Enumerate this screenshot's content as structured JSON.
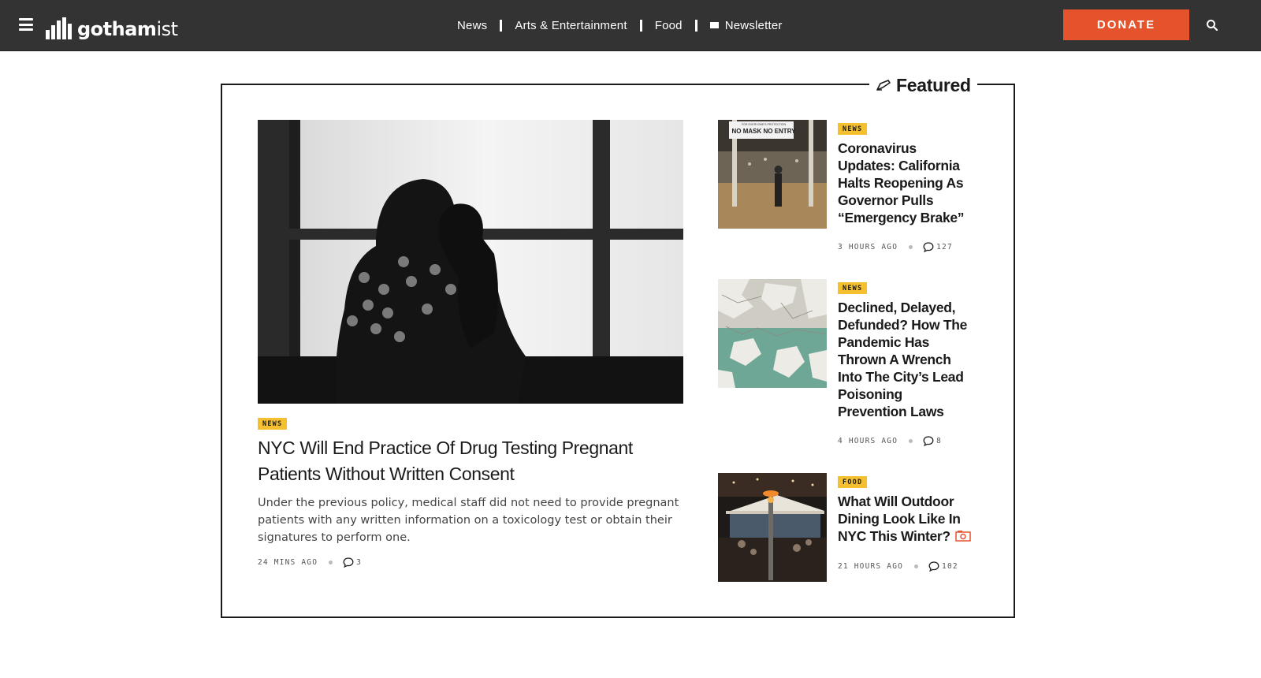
{
  "header": {
    "logo_text_bold": "gotham",
    "logo_text_light": "ist",
    "nav": [
      {
        "label": "News"
      },
      {
        "label": "Arts & Entertainment"
      },
      {
        "label": "Food"
      },
      {
        "label": "Newsletter",
        "icon": "mail-icon"
      }
    ],
    "donate_label": "DONATE",
    "search_icon": "search-icon",
    "menu_icon": "hamburger-icon"
  },
  "featured": {
    "heading": "Featured",
    "heading_icon": "pen-icon",
    "main": {
      "category": "NEWS",
      "title": "NYC Will End Practice Of Drug Testing Pregnant Patients Without Written Consent",
      "dek": "Under the previous policy, medical staff did not need to provide pregnant patients with any written information on a toxicology test or obtain their signatures to perform one.",
      "time": "24 MINS AGO",
      "comments": "3"
    },
    "side": [
      {
        "category": "NEWS",
        "title": "Coronavirus Updates: California Halts Reopening As Governor Pulls “Emergency Brake”",
        "time": "3 HOURS AGO",
        "comments": "127",
        "image_sign_text": "NO MASK NO ENTRY",
        "image_sign_small": "FOR EVERYONE'S PROTECTION"
      },
      {
        "category": "NEWS",
        "title": "Declined, Delayed, Defunded? How The Pandemic Has Thrown A Wrench Into The City’s Lead Poisoning Prevention Laws",
        "time": "4 HOURS AGO",
        "comments": "8"
      },
      {
        "category": "FOOD",
        "title": "What Will Outdoor Dining Look Like In NYC This Winter?",
        "time": "21 HOURS AGO",
        "comments": "102",
        "title_icon": "photo-gallery-icon"
      }
    ]
  },
  "colors": {
    "topbar": "#333333",
    "donate": "#e4532c",
    "badge": "#f5c030",
    "accent_icon": "#e4532c"
  }
}
